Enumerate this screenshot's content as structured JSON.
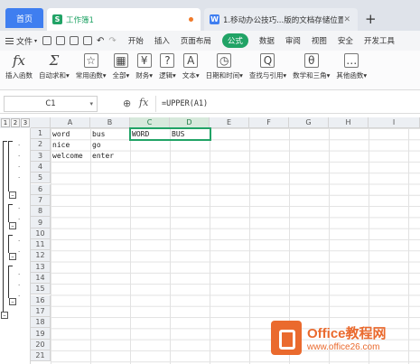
{
  "tabs": {
    "home": "首页",
    "active_doc": "工作簿1",
    "active_icon": "S",
    "other_doc": "1.移动办公技巧...版的文档存储位置",
    "other_icon": "W",
    "add": "+"
  },
  "menu": {
    "file": "文件",
    "items": [
      "开始",
      "插入",
      "页面布局",
      "公式",
      "数据",
      "审阅",
      "视图",
      "安全",
      "开发工具"
    ],
    "active": "公式"
  },
  "ribbon": {
    "buttons": [
      {
        "icon": "fx",
        "label": "插入函数"
      },
      {
        "icon": "Σ",
        "label": "自动求和▾"
      },
      {
        "icon": "☆",
        "label": "常用函数▾"
      },
      {
        "icon": "▦",
        "label": "全部▾"
      },
      {
        "icon": "¥",
        "label": "财务▾"
      },
      {
        "icon": "?",
        "label": "逻辑▾"
      },
      {
        "icon": "A",
        "label": "文本▾"
      },
      {
        "icon": "◷",
        "label": "日期和时间▾"
      },
      {
        "icon": "Q",
        "label": "查找与引用▾"
      },
      {
        "icon": "θ",
        "label": "数学和三角▾"
      },
      {
        "icon": "…",
        "label": "其他函数▾"
      }
    ]
  },
  "formula_bar": {
    "name_box": "C1",
    "formula": "=UPPER(A1)"
  },
  "sheet": {
    "outline_levels": [
      "1",
      "2",
      "3"
    ],
    "columns": [
      "A",
      "B",
      "C",
      "D",
      "E",
      "F",
      "G",
      "H",
      "I"
    ],
    "rows": [
      "1",
      "2",
      "3",
      "4",
      "5",
      "6",
      "7",
      "8",
      "9",
      "10",
      "11",
      "12",
      "13",
      "14",
      "15",
      "16",
      "17",
      "18",
      "19",
      "20",
      "21"
    ],
    "cells": {
      "A1": "word",
      "B1": "bus",
      "C1": "WORD",
      "D1": "BUS",
      "A2": "nice",
      "B2": "go",
      "A3": "welcome",
      "B3": "enter"
    },
    "selection": "C1:D1"
  },
  "watermark": {
    "title": "Office教程网",
    "url": "www.office26.com"
  },
  "colors": {
    "accent_green": "#21a366",
    "tab_blue": "#3f7ef0",
    "watermark_orange": "#ea6a2e"
  }
}
